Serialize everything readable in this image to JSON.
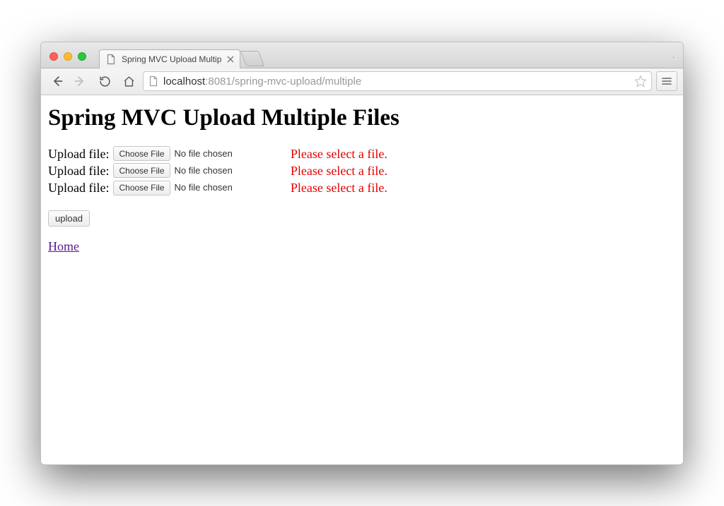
{
  "window": {
    "titlebar_right": "."
  },
  "tab": {
    "title": "Spring MVC Upload Multip"
  },
  "url": {
    "host": "localhost",
    "port": ":8081",
    "path": "/spring-mvc-upload/multiple"
  },
  "page": {
    "heading": "Spring MVC Upload Multiple Files",
    "rows": [
      {
        "label": "Upload file:",
        "button": "Choose File",
        "status": "No file chosen",
        "error": "Please select a file."
      },
      {
        "label": "Upload file:",
        "button": "Choose File",
        "status": "No file chosen",
        "error": "Please select a file."
      },
      {
        "label": "Upload file:",
        "button": "Choose File",
        "status": "No file chosen",
        "error": "Please select a file."
      }
    ],
    "submit_label": "upload",
    "home_label": "Home"
  }
}
